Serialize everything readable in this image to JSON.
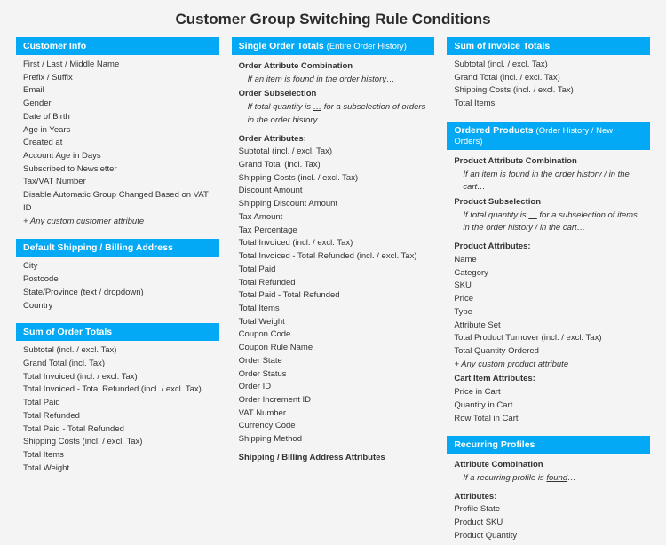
{
  "title": "Customer Group Switching Rule Conditions",
  "col1": {
    "customer_info": {
      "header": "Customer Info",
      "items": [
        "First / Last / Middle Name",
        "Prefix / Suffix",
        "Email",
        "Gender",
        "Date of Birth",
        "Age in Years",
        "Created at",
        "Account Age in Days",
        "Subscribed to Newsletter",
        "Tax/VAT Number",
        "Disable Automatic Group Changed Based on VAT ID"
      ],
      "plus_any": "+ Any custom customer attribute"
    },
    "default_address": {
      "header": "Default Shipping / Billing Address",
      "items": [
        "City",
        "Postcode",
        "State/Province (text / dropdown)",
        "Country"
      ]
    },
    "sum_order_totals": {
      "header": "Sum of Order Totals",
      "items": [
        "Subtotal (incl. / excl. Tax)",
        "Grand Total (incl. Tax)",
        "Total Invoiced (incl. / excl. Tax)",
        "Total Invoiced - Total Refunded (incl. / excl. Tax)",
        "Total Paid",
        "Total Refunded",
        "Total Paid - Total Refunded",
        "Shipping Costs (incl.  / excl. Tax)",
        "Total Items",
        "Total Weight"
      ]
    }
  },
  "col2": {
    "single_order": {
      "header_main": "Single Order Totals",
      "header_sub": "(Entire Order History)",
      "group1_title": "Order Attribute Combination",
      "group1_desc_pre": "If an item is ",
      "group1_desc_u": "found",
      "group1_desc_post": " in the order history…",
      "group2_title": "Order Subselection",
      "group2_desc_pre": "If total quantity is ",
      "group2_desc_u": "…",
      "group2_desc_post": " for a subselection of orders in the order history…",
      "attrs_heading": "Order Attributes:",
      "attrs": [
        "Subtotal  (incl. / excl. Tax)",
        "Grand Total (incl. Tax)",
        "Shipping Costs (incl. / excl. Tax)",
        "Discount Amount",
        "Shipping Discount Amount",
        "Tax Amount",
        "Tax Percentage",
        "Total Invoiced (incl. / excl. Tax)",
        "Total Invoiced - Total Refunded (incl. / excl. Tax)",
        "Total Paid",
        "Total Refunded",
        "Total Paid - Total Refunded",
        "Total Items",
        "Total Weight",
        "Coupon Code",
        "Coupon Rule Name",
        "Order State",
        "Order Status",
        "Order ID",
        "Order Increment ID",
        "VAT Number",
        "Currency Code",
        "Shipping Method"
      ],
      "ship_bill_heading": "Shipping / Billing Address Attributes"
    }
  },
  "col3": {
    "sum_invoice": {
      "header": "Sum of Invoice Totals",
      "items": [
        "Subtotal (incl. / excl. Tax)",
        "Grand Total (incl. / excl. Tax)",
        "Shipping Costs (incl. / excl. Tax)",
        "Total Items"
      ]
    },
    "ordered_products": {
      "header_main": "Ordered Products",
      "header_sub": "(Order History / New Orders)",
      "group1_title": "Product Attribute Combination",
      "group1_desc_pre": "If an item is ",
      "group1_desc_u": "found",
      "group1_desc_post": " in the order history / in the cart…",
      "group2_title": "Product Subselection",
      "group2_desc_pre": "If total quantity is ",
      "group2_desc_u": "…",
      "group2_desc_post": " for a subselection of items in the order history / in the cart…",
      "prod_attrs_heading": "Product Attributes:",
      "prod_attrs": [
        "Name",
        "Category",
        "SKU",
        "Price",
        "Type",
        "Attribute Set",
        "Total Product Turnover (incl. / excl. Tax)",
        "Total Quantity Ordered"
      ],
      "plus_any": "+ Any custom product attribute",
      "cart_attrs_heading": "Cart Item Attributes:",
      "cart_attrs": [
        "Price in Cart",
        "Quantity in Cart",
        "Row Total in Cart"
      ]
    },
    "recurring": {
      "header": "Recurring Profiles",
      "group1_title": "Attribute Combination",
      "group1_desc_pre": "If a recurring profile is ",
      "group1_desc_u": "found",
      "group1_desc_post": "…",
      "attrs_heading": "Attributes:",
      "attrs": [
        "Profile State",
        "Product SKU",
        "Product Quantity"
      ]
    }
  }
}
